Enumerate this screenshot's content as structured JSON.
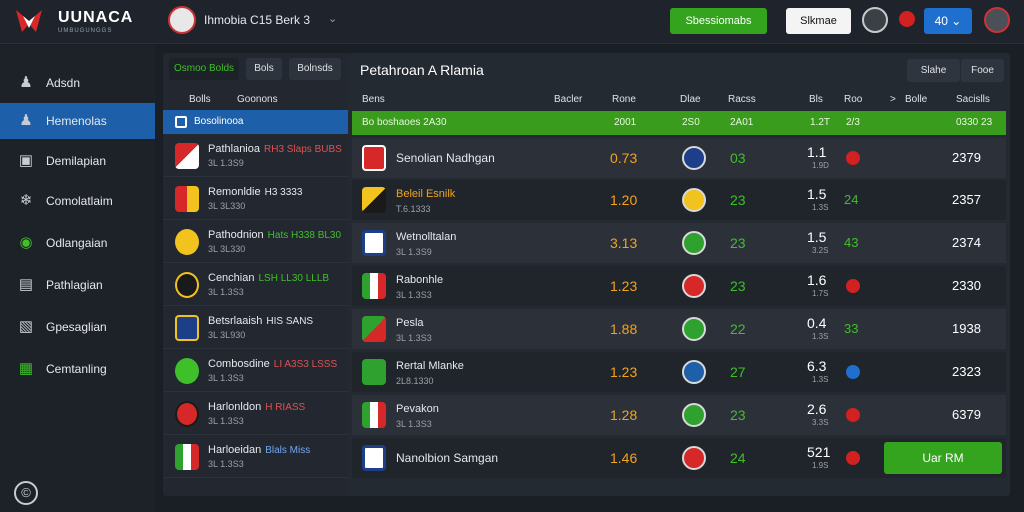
{
  "header": {
    "logo_title": "UUNACA",
    "logo_sub": "UMBUGUNGGS",
    "title": "Ihmobia C15 Berk 3",
    "chevron": "⌄",
    "green_btn": "Sbessiomabs",
    "white_btn": "Slkmae",
    "blue_btn": "40 ⌄"
  },
  "sidebar": {
    "items": [
      {
        "label": "Adsdn",
        "icon": "user-icon"
      },
      {
        "label": "Hemenolas",
        "icon": "users-icon"
      },
      {
        "label": "Demilapian",
        "icon": "image-icon"
      },
      {
        "label": "Comolatlaim",
        "icon": "puzzle-icon"
      },
      {
        "label": "Odlangaian",
        "icon": "circle-icon"
      },
      {
        "label": "Pathlagian",
        "icon": "document-icon"
      },
      {
        "label": "Gpesaglian",
        "icon": "swap-icon"
      },
      {
        "label": "Cemtanling",
        "icon": "grid-icon"
      }
    ],
    "bottom_icon": "©"
  },
  "teams": {
    "tabs": [
      "Osmoo Bolds",
      "Bols",
      "Bolnsds"
    ],
    "headers": [
      "Bolls",
      "Goonons"
    ],
    "selected": "Bosolinooa",
    "rows": [
      {
        "name": "Pathlanioa",
        "tag": "RH3 Slaps BUBS",
        "sub": "3L 1.3S9"
      },
      {
        "name": "Remonldie",
        "tag": "H3 3333",
        "sub": "3L 3L330"
      },
      {
        "name": "Pathodnion",
        "tag": "Hats H338 BL30",
        "sub": "3L 3L330"
      },
      {
        "name": "Cenchian",
        "tag": "LSH LL30 LLLB",
        "sub": "3L 1.3S3"
      },
      {
        "name": "Betsrlaaish",
        "tag": "HIS SANS",
        "sub": "3L 3L930"
      },
      {
        "name": "Combosdine",
        "tag": "LI A3S3 LSSS",
        "sub": "3L 1.3S3"
      },
      {
        "name": "Harlonldon",
        "tag": "H RIASS",
        "sub": "3L 1.3S3"
      },
      {
        "name": "Harloeidan",
        "tag": "Blals Miss",
        "sub": "3L 1.3S3"
      }
    ]
  },
  "main": {
    "title": "Petahroan A Rlamia",
    "btn_a": "Slahe",
    "btn_b": "Fooe",
    "headers": [
      "Bens",
      "Bacler",
      "Rone",
      "Dlae",
      "Racss",
      "Bls",
      "Roo",
      "Bolle",
      "Sacislls"
    ],
    "header_arrow": ">",
    "bar": [
      "Bo boshaoes 2A30",
      "2001",
      "2S0",
      "2A01",
      "1.2T",
      "2/3",
      "0330 23"
    ],
    "rows": [
      {
        "team": "Senolian Nadhgan",
        "sub": "",
        "odd1": "0.73",
        "odd2": "03",
        "odd3": "1.1",
        "odd3sub": "1.9D",
        "odd4": "",
        "dot": "red",
        "val": "2379"
      },
      {
        "team": "Beleil Esnilk",
        "sub": "T.6.1333",
        "odd1": "1.20",
        "odd2": "23",
        "odd3": "1.5",
        "odd3sub": "1.3S",
        "odd4": "24",
        "dot": "",
        "val": "2357"
      },
      {
        "team": "Wetnolltalan",
        "sub": "3L 1.3S9",
        "odd1": "3.13",
        "odd2": "23",
        "odd3": "1.5",
        "odd3sub": "3.2S",
        "odd4": "43",
        "dot": "",
        "val": "2374"
      },
      {
        "team": "Rabonhle",
        "sub": "3L 1.3S3",
        "odd1": "1.23",
        "odd2": "23",
        "odd3": "1.6",
        "odd3sub": "1.7S",
        "odd4": "",
        "dot": "red",
        "val": "2330"
      },
      {
        "team": "Pesla",
        "sub": "3L 1.3S3",
        "odd1": "1.88",
        "odd2": "22",
        "odd3": "0.4",
        "odd3sub": "1.3S",
        "odd4": "33",
        "dot": "",
        "val": "1938"
      },
      {
        "team": "Rertal Mlanke",
        "sub": "2L8.1330",
        "odd1": "1.23",
        "odd2": "27",
        "odd3": "6.3",
        "odd3sub": "1.3S",
        "odd4": "",
        "dot": "blue",
        "val": "2323"
      },
      {
        "team": "Pevakon",
        "sub": "3L 1.3S3",
        "odd1": "1.28",
        "odd2": "23",
        "odd3": "2.6",
        "odd3sub": "3.3S",
        "odd4": "",
        "dot": "red",
        "val": "6379"
      },
      {
        "team": "Nanolbion Samgan",
        "sub": "",
        "odd1": "1.46",
        "odd2": "24",
        "odd3": "521",
        "odd3sub": "1.9S",
        "odd4": "",
        "dot": "red",
        "val": ""
      }
    ],
    "cta": "Uar RM"
  },
  "colors": {
    "accent_green": "#34a31e",
    "accent_blue": "#1d5fa8",
    "odds_orange": "#f2a31e",
    "odds_green": "#3fbf2a"
  }
}
